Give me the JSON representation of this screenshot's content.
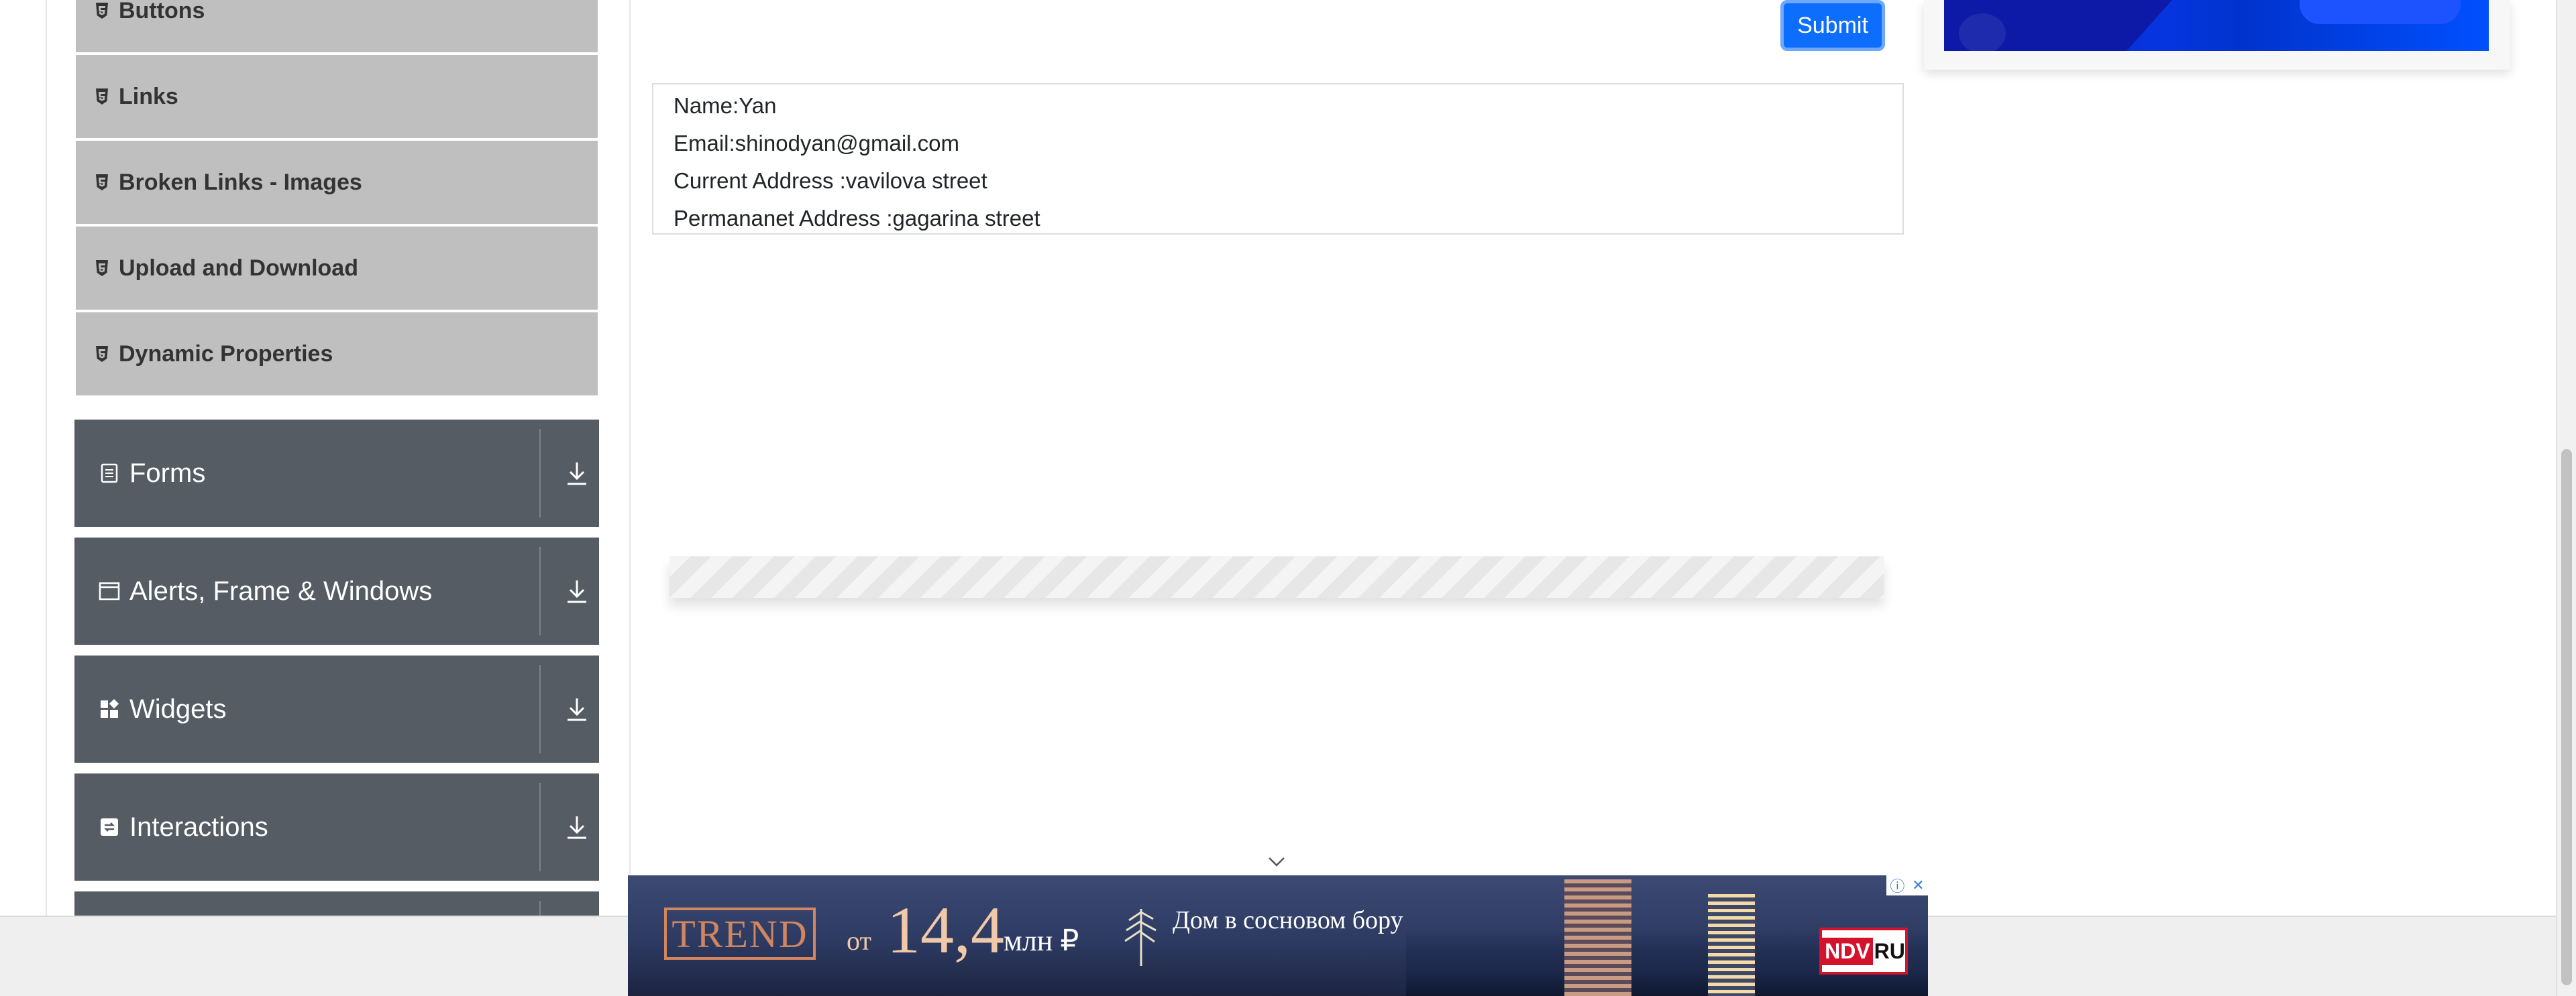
{
  "sidebar": {
    "elements_items": [
      {
        "label": "Buttons",
        "icon": "html5-icon"
      },
      {
        "label": "Links",
        "icon": "html5-icon"
      },
      {
        "label": "Broken Links - Images",
        "icon": "html5-icon"
      },
      {
        "label": "Upload and Download",
        "icon": "html5-icon"
      },
      {
        "label": "Dynamic Properties",
        "icon": "html5-icon"
      }
    ],
    "groups": [
      {
        "label": "Forms",
        "icon": "form-icon"
      },
      {
        "label": "Alerts, Frame & Windows",
        "icon": "window-icon"
      },
      {
        "label": "Widgets",
        "icon": "widgets-icon"
      },
      {
        "label": "Interactions",
        "icon": "interactions-icon"
      },
      {
        "label": "",
        "icon": "book-icon"
      }
    ]
  },
  "form": {
    "submit_label": "Submit"
  },
  "output": {
    "name": "Name:Yan",
    "email": "Email:shinodyan@gmail.com",
    "current_address": "Current Address :vavilova street",
    "permanent_address": "Permananet Address :gagarina street"
  },
  "banner": {
    "logo_text": "TREND",
    "price_prefix": "от",
    "price": "14,4",
    "price_unit": "млн ₽",
    "tagline": "Дом в сосновом бору",
    "brand_red": "NDV",
    "brand_suffix": "RU"
  },
  "colors": {
    "sidebar_group_bg": "#555c64",
    "sidebar_item_bg": "#bfbfbf",
    "submit_bg": "#0d6efd"
  }
}
